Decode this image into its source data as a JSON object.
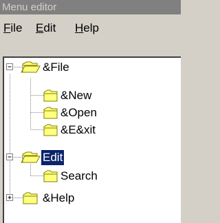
{
  "window": {
    "title": "Menu editor"
  },
  "menubar": {
    "file": {
      "mnemonic": "F",
      "rest": "ile"
    },
    "edit": {
      "mnemonic": "E",
      "rest": "dit"
    },
    "help": {
      "mnemonic": "H",
      "rest": "elp"
    }
  },
  "tree": {
    "nodes": [
      {
        "label": "&File",
        "expanded": true,
        "icon": "open-folder-icon"
      },
      {
        "label": "&New",
        "icon": "folder-icon"
      },
      {
        "label": "&Open",
        "icon": "folder-icon"
      },
      {
        "label": "&E&xit",
        "icon": "folder-icon"
      },
      {
        "label": "Edit",
        "expanded": true,
        "selected": true,
        "icon": "open-folder-icon"
      },
      {
        "label": "Search",
        "icon": "folder-icon"
      },
      {
        "label": "&Help",
        "expanded": false,
        "icon": "folder-icon"
      }
    ]
  },
  "colors": {
    "selection": "#0a246a",
    "folder": "#ffff80",
    "folder_outline": "#808000",
    "tree_lines": "#808080"
  }
}
